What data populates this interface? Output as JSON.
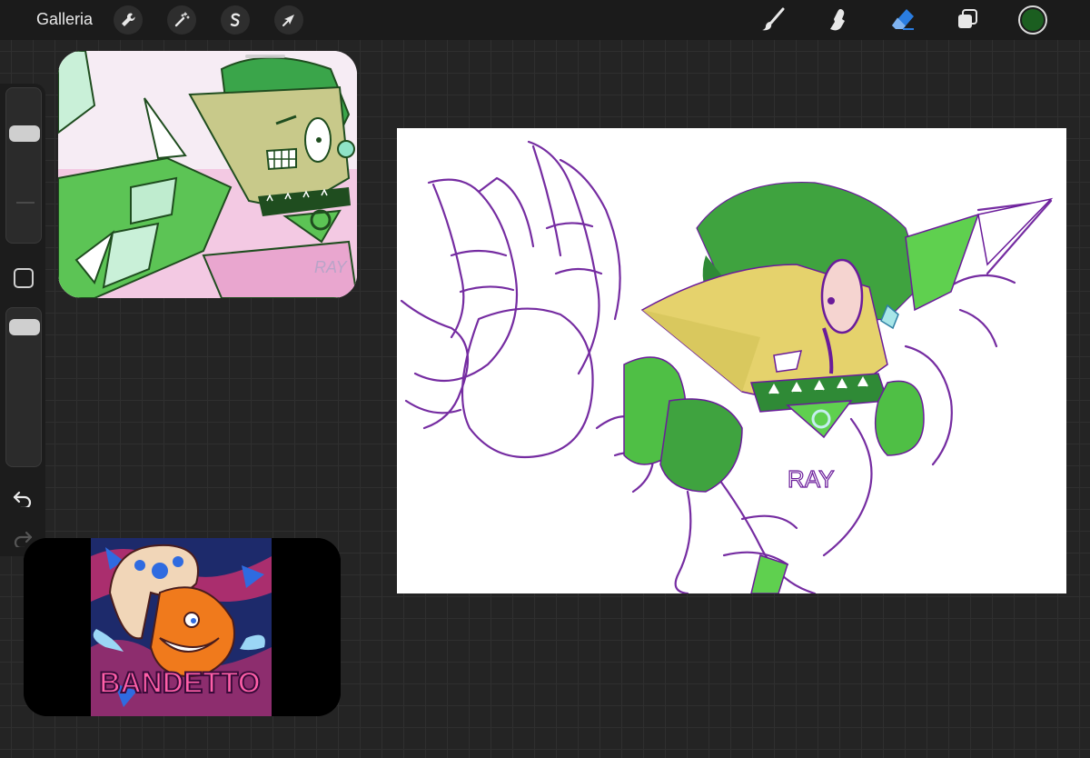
{
  "app": {
    "gallery_label": "Galleria"
  },
  "colors": {
    "current_color": "#1b5e20",
    "active_tool": "#2a7de1",
    "sketch_stroke": "#6a1b9a",
    "character_green": "#3fa33f"
  },
  "toolbar": {
    "left_tools": [
      "wrench-icon",
      "magic-wand-icon",
      "selection-icon",
      "arrow-icon"
    ],
    "right_tools": [
      "brush-icon",
      "smudge-icon",
      "eraser-icon",
      "layers-icon"
    ],
    "active_tool": "eraser"
  },
  "sidebar": {
    "brush_size_level": 0.75,
    "opacity_level": 0.95,
    "undo": "undo-icon",
    "redo": "redo-icon"
  },
  "references": {
    "ref1": {
      "signature": "RAY"
    },
    "ref2": {
      "logo_text": "BANDETTO"
    }
  },
  "canvas": {
    "signature": "RAY"
  }
}
